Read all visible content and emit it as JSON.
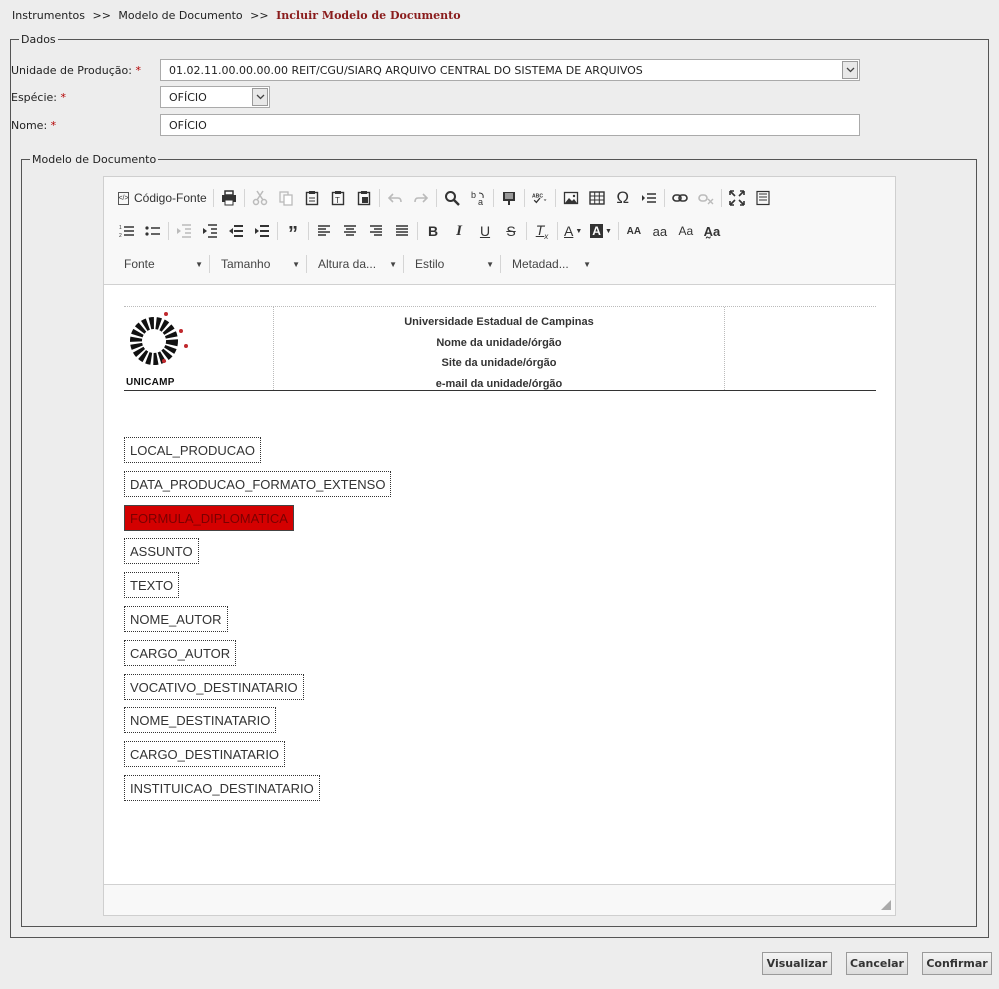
{
  "breadcrumb": {
    "items": [
      "Instrumentos",
      "Modelo de Documento"
    ],
    "separator": ">>",
    "current": "Incluir Modelo de Documento"
  },
  "dados": {
    "legend": "Dados",
    "unidade": {
      "label": "Unidade de Produção:",
      "required": "*",
      "value": "01.02.11.00.00.00.00 REIT/CGU/SIARQ ARQUIVO CENTRAL DO SISTEMA DE ARQUIVOS"
    },
    "especie": {
      "label": "Espécie:",
      "required": "*",
      "value": "OFÍCIO"
    },
    "nome": {
      "label": "Nome:",
      "required": "*",
      "value": "OFÍCIO"
    }
  },
  "modelo": {
    "legend": "Modelo de Documento",
    "toolbar": {
      "source_label": "Código-Fonte",
      "source_icon": "page-source-icon",
      "combos": {
        "fonte": "Fonte",
        "tamanho": "Tamanho",
        "altura": "Altura da...",
        "estilo": "Estilo",
        "metadados": "Metadad..."
      }
    },
    "header": {
      "logo_text": "UNICAMP",
      "lines": [
        "Universidade Estadual de Campinas",
        "Nome da unidade/órgão",
        "Site da unidade/órgão",
        "e-mail da unidade/órgão"
      ]
    },
    "fields": [
      "LOCAL_PRODUCAO",
      "DATA_PRODUCAO_FORMATO_EXTENSO",
      "FORMULA_DIPLOMATICA",
      "ASSUNTO",
      "TEXTO",
      "NOME_AUTOR",
      "CARGO_AUTOR",
      "VOCATIVO_DESTINATARIO",
      "NOME_DESTINATARIO",
      "CARGO_DESTINATARIO",
      "INSTITUICAO_DESTINATARIO"
    ],
    "highlight_color": "#d40000"
  },
  "actions": {
    "visualizar": "Visualizar",
    "cancelar": "Cancelar",
    "confirmar": "Confirmar"
  },
  "colors": {
    "breadcrumb_current": "#8a1c1c",
    "required": "#b30000",
    "background": "#ededed"
  }
}
